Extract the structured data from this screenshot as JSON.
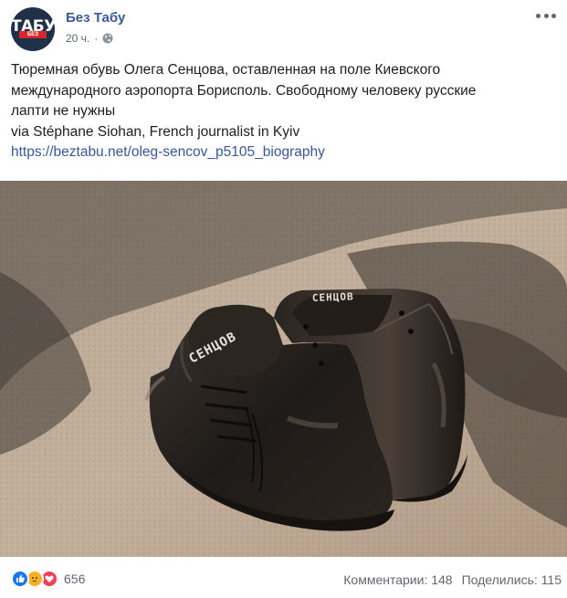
{
  "post": {
    "author": "Без Табу",
    "avatar_text": "ТАБУ",
    "avatar_small": "БЕЗ",
    "time": "20 ч.",
    "separator": "·",
    "privacy_icon": "globe-icon",
    "more_icon": "more-options-icon",
    "text_lines": [
      "Тюремная обувь Олега Сенцова, оставленная на поле Киевского",
      "международного аэропорта Борисполь. Свободному человеку русские",
      "лапти не нужны",
      "via Stéphane Siohan, French journalist in Kyiv"
    ],
    "link": "https://beztabu.net/oleg-sencov_p5105_biography"
  },
  "photo": {
    "left_tongue_label": "СЕНЦОВ",
    "right_tongue_label": "СЕНЦОВ"
  },
  "footer": {
    "reactions": [
      "like-icon",
      "sad-icon",
      "love-icon"
    ],
    "reaction_count": "656",
    "comments": "Комментарии: 148",
    "shares": "Поделились: 115"
  },
  "colors": {
    "link": "#385898",
    "text": "#1c1e21",
    "meta": "#616770",
    "like": "#1877f2",
    "sad": "#f7b125",
    "love": "#f33e58"
  }
}
